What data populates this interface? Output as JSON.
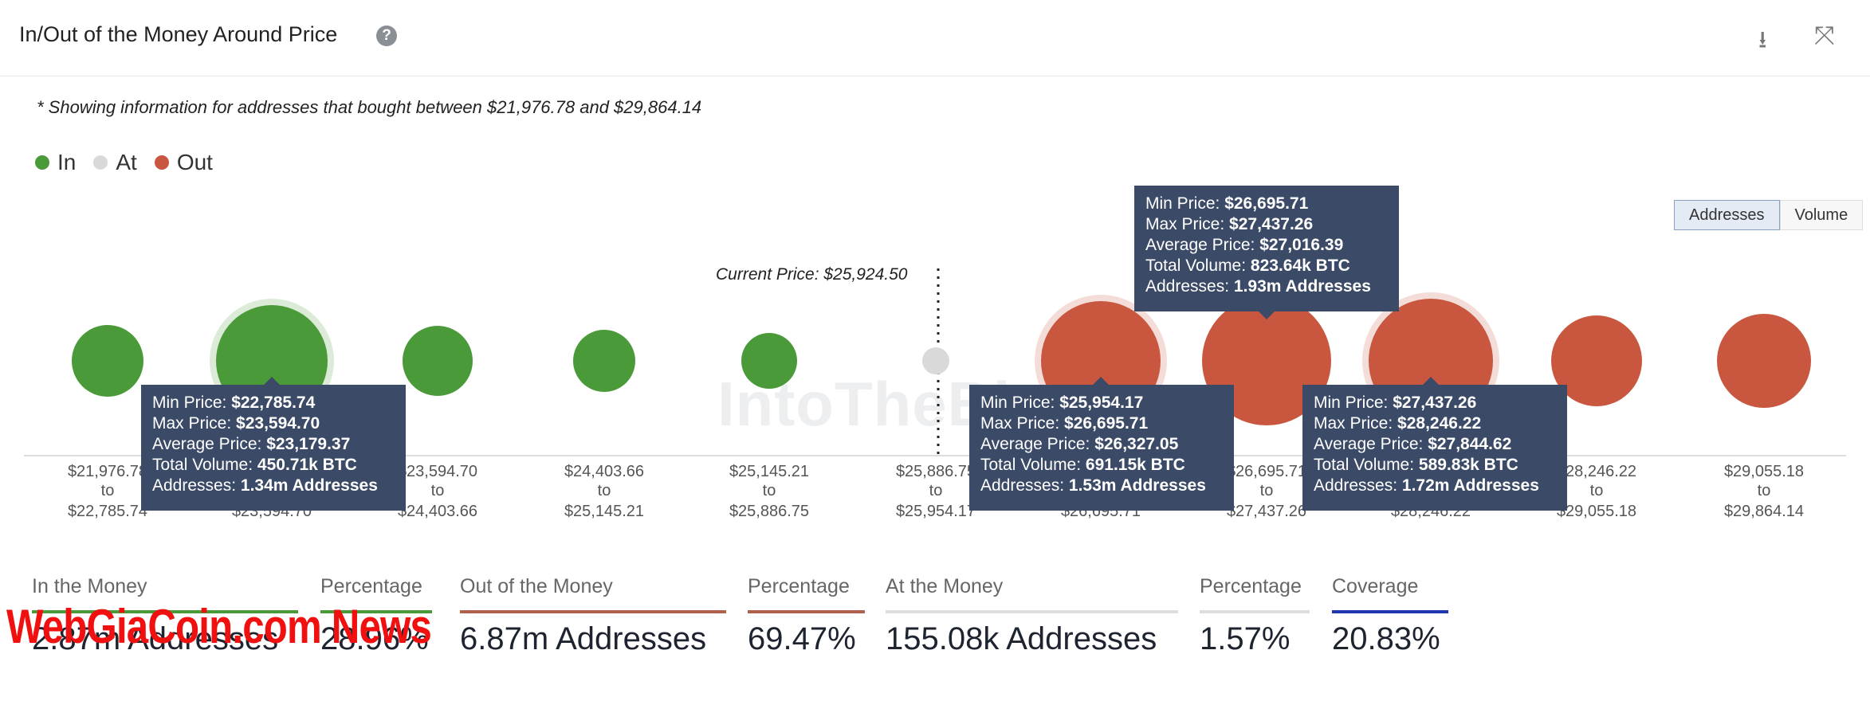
{
  "header": {
    "title": "In/Out of the Money Around Price",
    "help_icon": "?",
    "download_icon": "download-icon",
    "fullscreen_icon": "expand-icon"
  },
  "note": "* Showing information for addresses that bought between $21,976.78 and $29,864.14",
  "legend": [
    {
      "label": "In",
      "color": "#4a9a3a"
    },
    {
      "label": "At",
      "color": "#d9d9d9"
    },
    {
      "label": "Out",
      "color": "#c9563e"
    }
  ],
  "toggle": {
    "addresses": "Addresses",
    "volume": "Volume",
    "selected": "Addresses"
  },
  "logo_text": "IntoTheBlock",
  "chart_data": {
    "type": "bubble",
    "current_price_label": "Current Price: $25,924.50",
    "buckets": [
      {
        "from": "$21,976.78",
        "to": "$22,785.74",
        "status": "In"
      },
      {
        "from": "$22,785.74",
        "to": "$23,594.70",
        "status": "In"
      },
      {
        "from": "$23,594.70",
        "to": "$24,403.66",
        "status": "In"
      },
      {
        "from": "$24,403.66",
        "to": "$25,145.21",
        "status": "In"
      },
      {
        "from": "$25,145.21",
        "to": "$25,886.75",
        "status": "In"
      },
      {
        "from": "$25,886.75",
        "to": "$25,954.17",
        "status": "At"
      },
      {
        "from": "$25,954.17",
        "to": "$26,695.71",
        "status": "Out"
      },
      {
        "from": "$26,695.71",
        "to": "$27,437.26",
        "status": "Out"
      },
      {
        "from": "$27,437.26",
        "to": "$28,246.22",
        "status": "Out"
      },
      {
        "from": "$28,246.22",
        "to": "$29,055.18",
        "status": "Out"
      },
      {
        "from": "$29,055.18",
        "to": "$29,864.14",
        "status": "Out"
      }
    ],
    "to_word": "to",
    "tooltips": [
      {
        "bucket": 1,
        "min": "$22,785.74",
        "max": "$23,594.70",
        "avg": "$23,179.37",
        "volume": "450.71k BTC",
        "addresses": "1.34m Addresses"
      },
      {
        "bucket": 6,
        "min": "$25,954.17",
        "max": "$26,695.71",
        "avg": "$26,327.05",
        "volume": "691.15k BTC",
        "addresses": "1.53m Addresses"
      },
      {
        "bucket": 7,
        "min": "$26,695.71",
        "max": "$27,437.26",
        "avg": "$27,016.39",
        "volume": "823.64k BTC",
        "addresses": "1.93m Addresses"
      },
      {
        "bucket": 8,
        "min": "$27,437.26",
        "max": "$28,246.22",
        "avg": "$27,844.62",
        "volume": "589.83k BTC",
        "addresses": "1.72m Addresses"
      }
    ],
    "tooltip_labels": {
      "min": "Min Price: ",
      "max": "Max Price: ",
      "avg": "Average Price: ",
      "volume": "Total Volume: ",
      "addresses": "Addresses: "
    }
  },
  "summary": [
    {
      "label": "In the Money",
      "value": "2.87m Addresses",
      "color": "#4a9a3a"
    },
    {
      "label": "Percentage",
      "value": "28.96%",
      "color": "#4a9a3a"
    },
    {
      "label": "Out of the Money",
      "value": "6.87m Addresses",
      "color": "#b0614e"
    },
    {
      "label": "Percentage",
      "value": "69.47%",
      "color": "#b0614e"
    },
    {
      "label": "At the Money",
      "value": "155.08k Addresses",
      "color": "#dddddd"
    },
    {
      "label": "Percentage",
      "value": "1.57%",
      "color": "#dddddd"
    },
    {
      "label": "Coverage",
      "value": "20.83%",
      "color": "#2236b0"
    }
  ],
  "watermark": "WebGiaCoin.com News"
}
